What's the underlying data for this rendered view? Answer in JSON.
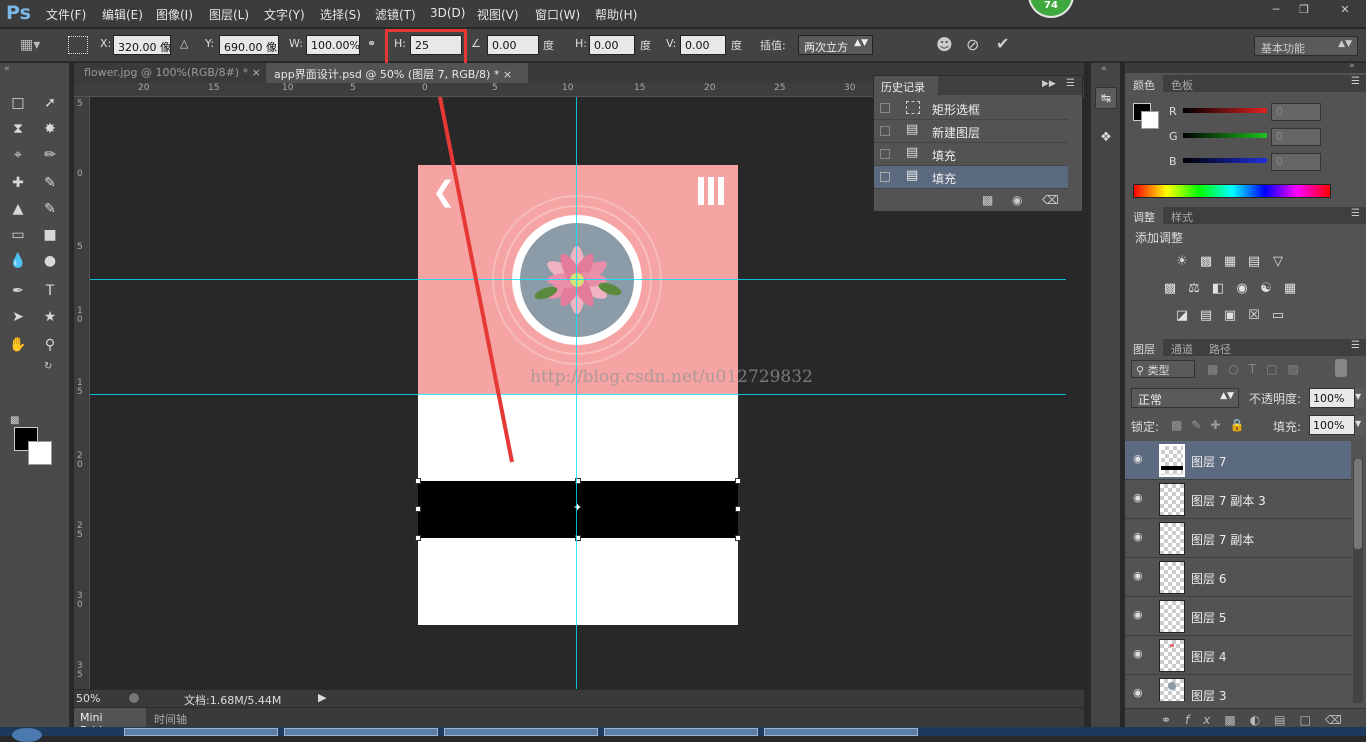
{
  "app": {
    "logo": "Ps",
    "update_badge": "74"
  },
  "menu": [
    "文件(F)",
    "编辑(E)",
    "图像(I)",
    "图层(L)",
    "文字(Y)",
    "选择(S)",
    "滤镜(T)",
    "3D(D)",
    "视图(V)",
    "窗口(W)",
    "帮助(H)"
  ],
  "options": {
    "x_label": "X:",
    "x_value": "320.00 像",
    "y_label": "Y:",
    "y_value": "690.00 像",
    "w_label": "W:",
    "w_value": "100.00%",
    "h_label": "H:",
    "h_value": "25",
    "angle_value": "0.00",
    "angle_unit": "度",
    "hskew_label": "H:",
    "hskew_value": "0.00",
    "hskew_unit": "度",
    "vskew_label": "V:",
    "vskew_value": "0.00",
    "vskew_unit": "度",
    "interp_label": "插值:",
    "interp_value": "两次立方",
    "workspace": "基本功能"
  },
  "tabs": [
    {
      "label": "flower.jpg @ 100%(RGB/8#) *",
      "active": false
    },
    {
      "label": "app界面设计.psd @ 50% (图层 7, RGB/8) *",
      "active": true
    }
  ],
  "rulers": {
    "h": [
      "20",
      "15",
      "10",
      "5",
      "0",
      "5",
      "10",
      "15",
      "20",
      "25",
      "30"
    ],
    "v": [
      "5",
      "0",
      "5",
      "1 0",
      "1 5",
      "2 0",
      "2 5",
      "3 0",
      "3 5"
    ]
  },
  "canvas": {
    "watermark": "http://blog.csdn.net/u012729832"
  },
  "status": {
    "zoom": "50%",
    "doc_info": "文档:1.68M/5.44M"
  },
  "bottom_tabs": [
    "Mini Bridge",
    "时间轴"
  ],
  "history": {
    "title": "历史记录",
    "items": [
      "矩形选框",
      "新建图层",
      "填充",
      "填充"
    ],
    "selected_index": 3
  },
  "color_panel": {
    "tabs": [
      "颜色",
      "色板"
    ],
    "channels": [
      {
        "label": "R",
        "value": "0",
        "color": "#e02020"
      },
      {
        "label": "G",
        "value": "0",
        "color": "#20c020"
      },
      {
        "label": "B",
        "value": "0",
        "color": "#2030e0"
      }
    ]
  },
  "adjust_panel": {
    "tabs": [
      "调整",
      "样式"
    ],
    "title": "添加调整"
  },
  "layers_panel": {
    "tabs": [
      "图层",
      "通道",
      "路径"
    ],
    "filter": "类型",
    "blend_mode": "正常",
    "opacity_label": "不透明度:",
    "opacity_value": "100%",
    "lock_label": "锁定:",
    "fill_label": "填充:",
    "fill_value": "100%",
    "layers": [
      "图层 7",
      "图层 7 副本 3",
      "图层 7 副本",
      "图层 6",
      "图层 5",
      "图层 4",
      "图层 3"
    ],
    "selected_index": 0
  },
  "colors": {
    "accent_red": "#e53935",
    "guide": "#00e5ff",
    "doc_pink": "#f5a4a3"
  }
}
